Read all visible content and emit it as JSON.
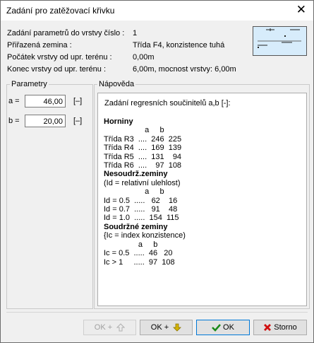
{
  "window": {
    "title": "Zadání pro zatěžovací křivku"
  },
  "info": {
    "rows": [
      {
        "label": "Zadání parametrů do vrstvy číslo :",
        "value": "1"
      },
      {
        "label": "Přiřazená zemina :",
        "value": "Třída F4, konzistence tuhá"
      },
      {
        "label": "Počátek vrstvy od upr. terénu :",
        "value": "0,00m"
      },
      {
        "label": "Konec vrstvy od upr. terénu :",
        "value": "6,00m, mocnost vrstvy: 6,00m"
      }
    ]
  },
  "parametry": {
    "legend": "Parametry",
    "a": {
      "label": "a =",
      "value": "46,00",
      "unit": "[–]"
    },
    "b": {
      "label": "b =",
      "value": "20,00",
      "unit": "[–]"
    }
  },
  "napoveda": {
    "legend": "Nápověda",
    "title": "Zadání regresních součinitelů a,b [-]:",
    "section1_heading": "Horniny",
    "section1_cols": "                   a     b",
    "section1_rows": [
      "Třída R3  ....  246  225",
      "Třída R4  ....  169  139",
      "Třída R5  ....  131    94",
      "Třída R6  ....    97  108"
    ],
    "section2_heading": "Nesoudrž.zeminy",
    "section2_sub": "(Id = relativní ulehlost)",
    "section2_cols": "                   a     b",
    "section2_rows": [
      "Id = 0.5  .....   62    16",
      "Id = 0.7  .....   91    48",
      "Id = 1.0  .....  154  115"
    ],
    "section3_heading": "Soudržné zeminy",
    "section3_sub": "{Ic = index konzistence)",
    "section3_cols": "                a     b",
    "section3_rows": [
      "Ic = 0.5  .....  46   20",
      "Ic > 1     .....  97  108"
    ]
  },
  "buttons": {
    "ok_plus_up": "OK +",
    "ok_plus_down": "OK +",
    "ok": "OK",
    "storno": "Storno"
  },
  "colors": {
    "ok_check": "#1a8a1a",
    "storno_x": "#d01010",
    "arrow_yellow": "#d4b400",
    "thumb_fill": "#d7ecfb"
  },
  "icons": [
    "close-icon",
    "arrow-up-icon",
    "arrow-down-icon",
    "check-icon",
    "x-icon"
  ]
}
